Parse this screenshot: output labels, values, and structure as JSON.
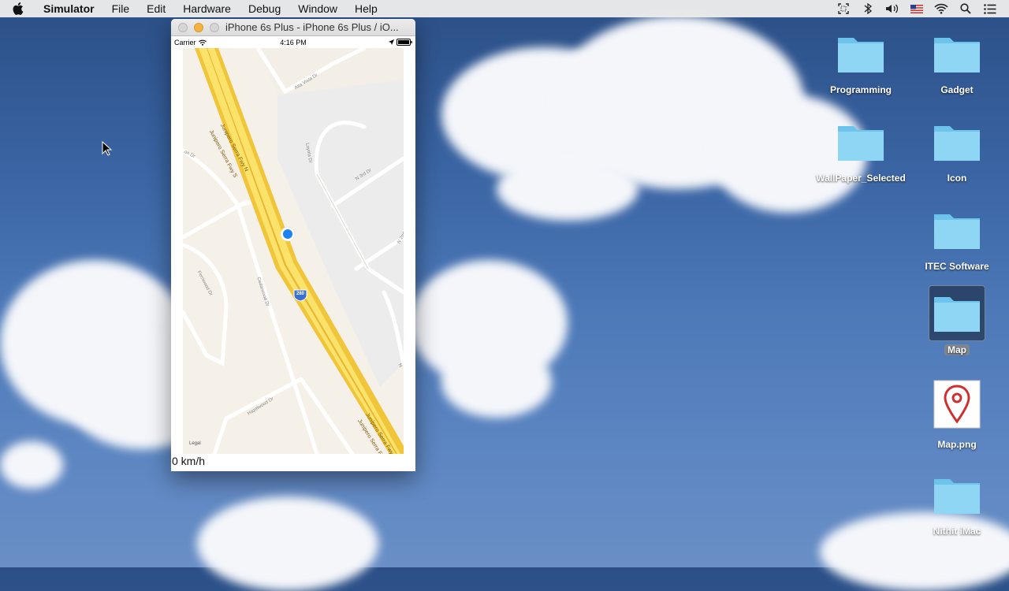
{
  "menubar": {
    "app_name": "Simulator",
    "items": [
      "File",
      "Edit",
      "Hardware",
      "Debug",
      "Window",
      "Help"
    ]
  },
  "window": {
    "title": "iPhone 6s Plus - iPhone 6s Plus / iO..."
  },
  "phone": {
    "carrier": "Carrier",
    "time": "4:16 PM",
    "speed": "0 km/h"
  },
  "map": {
    "legal": "Legal",
    "highway_shield": "280",
    "street_labels": [
      "Junipero Serra Fwy N",
      "Junipero Serra Fwy S",
      "Alta Vista Dr",
      "Loyola Dr",
      "N 3rd Dr",
      "N 2nd",
      "Fernwood Dr",
      "Cedarwood Dr",
      "Hazelwood Dr",
      "N",
      "on Dr"
    ]
  },
  "desktop": {
    "icons": [
      {
        "label": "Programming",
        "kind": "folder"
      },
      {
        "label": "Gadget",
        "kind": "folder"
      },
      {
        "label": "WallPaper_Selected",
        "kind": "folder"
      },
      {
        "label": "Icon",
        "kind": "folder"
      },
      {
        "label": "ITEC Software",
        "kind": "folder"
      },
      {
        "label": "Map",
        "kind": "folder",
        "selected": true
      },
      {
        "label": "Map.png",
        "kind": "image"
      },
      {
        "label": "Nithit iMac",
        "kind": "folder"
      }
    ]
  },
  "colors": {
    "folder": "#7fd0f2",
    "highway": "#f9d649",
    "location_dot": "#1a82f5"
  }
}
